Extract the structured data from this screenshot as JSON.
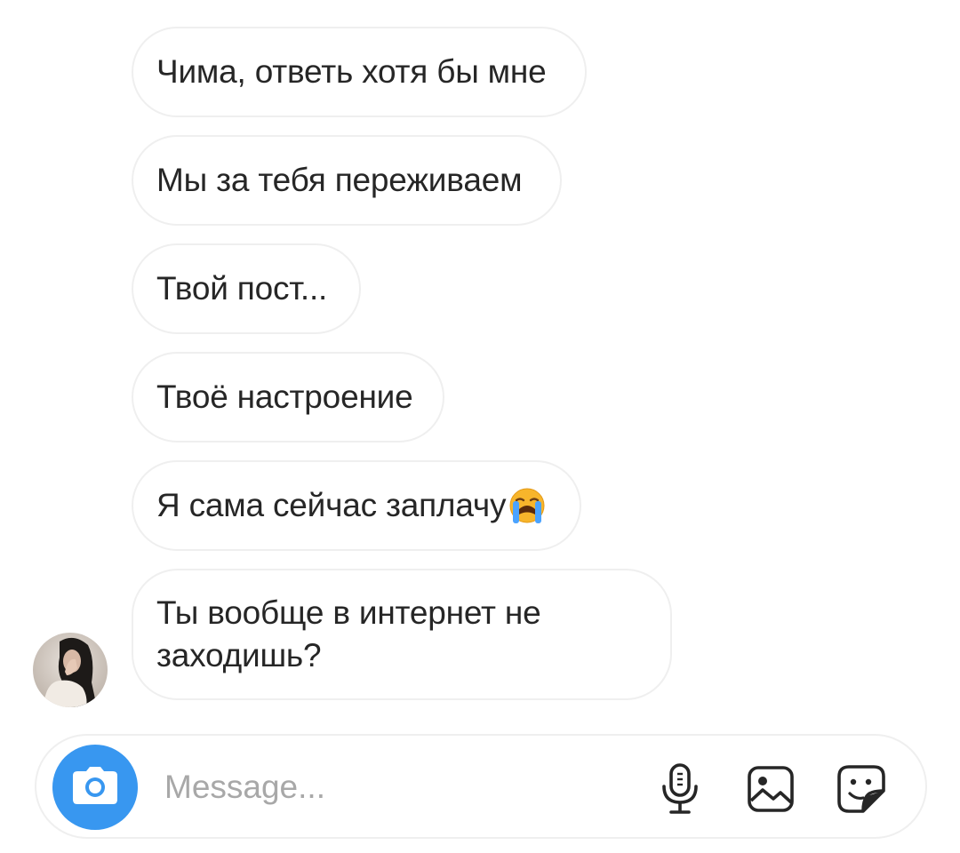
{
  "thread": {
    "messages": [
      {
        "text": "Чима, ответь хотя бы мне"
      },
      {
        "text": "Мы за тебя переживаем"
      },
      {
        "text": "Твой пост..."
      },
      {
        "text": "Твоё настроение"
      },
      {
        "text": "Я сама сейчас заплачу",
        "emoji": "loudly-crying-face"
      },
      {
        "text_line1": "Ты вообще в интернет не",
        "text_line2": "заходишь?"
      }
    ],
    "sender_avatar": "user-avatar-photo"
  },
  "composer": {
    "placeholder": "Message...",
    "icons": [
      "camera-icon",
      "microphone-icon",
      "gallery-icon",
      "sticker-icon"
    ],
    "camera_button_color": "#3897f0"
  },
  "colors": {
    "bubble_border": "#efefef",
    "text": "#262626",
    "placeholder": "#a8a8a8"
  }
}
